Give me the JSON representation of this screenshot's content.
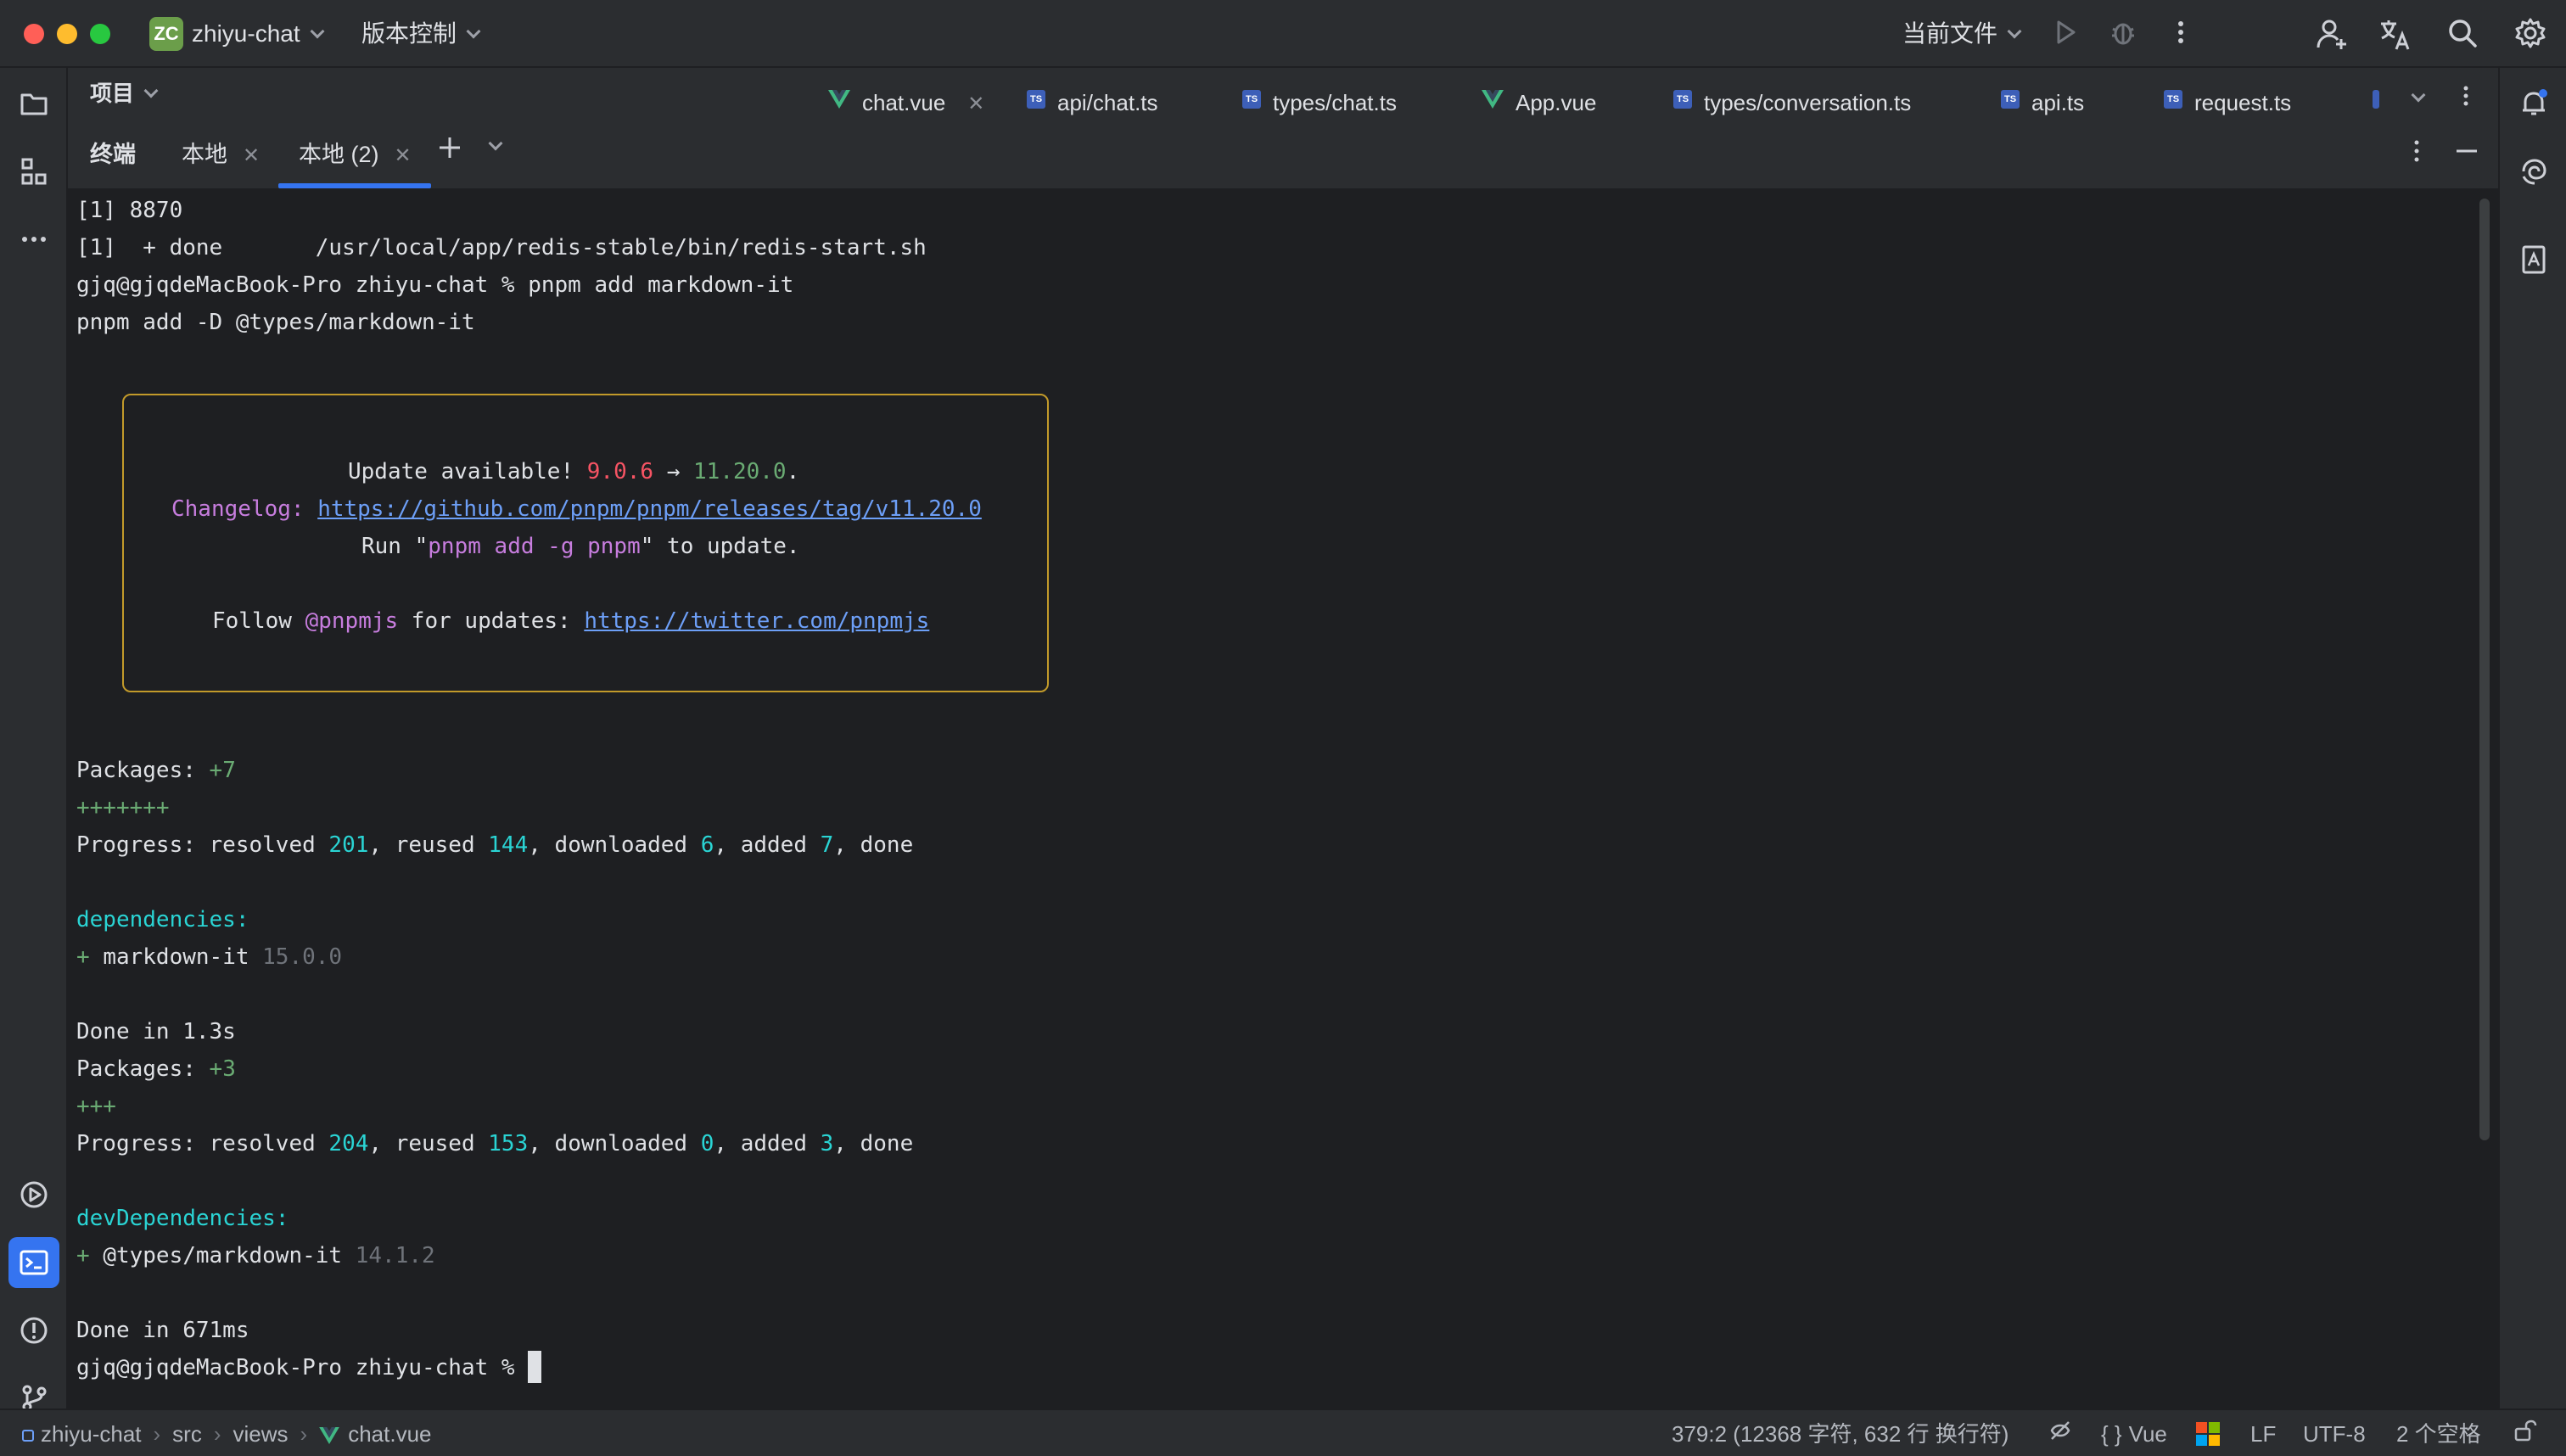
{
  "titlebar": {
    "project_badge": "ZC",
    "project_name": "zhiyu-chat",
    "vcs": "版本控制",
    "run_config": "当前文件"
  },
  "editor": {
    "project_label": "项目",
    "tabs": [
      {
        "label": "chat.vue",
        "icon": "vue-icon",
        "active": true
      },
      {
        "label": "api/chat.ts",
        "icon": "ts-icon"
      },
      {
        "label": "types/chat.ts",
        "icon": "ts-icon"
      },
      {
        "label": "App.vue",
        "icon": "vue-icon"
      },
      {
        "label": "types/conversation.ts",
        "icon": "ts-icon"
      },
      {
        "label": "api.ts",
        "icon": "ts-icon"
      },
      {
        "label": "request.ts",
        "icon": "ts-icon"
      }
    ]
  },
  "terminal_bar": {
    "title": "终端",
    "tab1": "本地",
    "tab2": "本地 (2)"
  },
  "terminal": {
    "l1": "[1] 8870",
    "l2": "[1]  + done       /usr/local/app/redis-stable/bin/redis-start.sh",
    "l3": "gjq@gjqdeMacBook-Pro zhiyu-chat % pnpm add markdown-it",
    "l4": "pnpm add -D @types/markdown-it",
    "update_prefix": "Update available! ",
    "update_from": "9.0.6",
    "update_arrow": " → ",
    "update_to": "11.20.0",
    "update_dot": ".",
    "changelog_label": "Changelog: ",
    "changelog_url": "https://github.com/pnpm/pnpm/releases/tag/v11.20.0",
    "run_prefix": "Run \"",
    "run_cmd": "pnpm add -g pnpm",
    "run_suffix": "\" to update.",
    "follow_prefix": "Follow ",
    "follow_handle": "@pnpmjs",
    "follow_mid": " for updates: ",
    "follow_url": "https://twitter.com/pnpmjs",
    "pkg1_label": "Packages: ",
    "pkg1_count": "+7",
    "pkg1_plus": "+++++++",
    "prog1": {
      "a": "Progress: resolved ",
      "resolved": "201",
      "b": ", reused ",
      "reused": "144",
      "c": ", downloaded ",
      "downloaded": "6",
      "d": ", added ",
      "added": "7",
      "e": ", done"
    },
    "deps_label": "dependencies:",
    "dep_plus": "+ ",
    "dep_name": "markdown-it ",
    "dep_version": "15.0.0",
    "done1": "Done in 1.3s",
    "pkg2_label": "Packages: ",
    "pkg2_count": "+3",
    "pkg2_plus": "+++",
    "prog2": {
      "a": "Progress: resolved ",
      "resolved": "204",
      "b": ", reused ",
      "reused": "153",
      "c": ", downloaded ",
      "downloaded": "0",
      "d": ", added ",
      "added": "3",
      "e": ", done"
    },
    "devdeps_label": "devDependencies:",
    "devdep_plus": "+ ",
    "devdep_name": "@types/markdown-it ",
    "devdep_version": "14.1.2",
    "done2": "Done in 671ms",
    "prompt": "gjq@gjqdeMacBook-Pro zhiyu-chat % "
  },
  "statusbar": {
    "crumb1": "zhiyu-chat",
    "crumb2": "src",
    "crumb3": "views",
    "crumb4": "chat.vue",
    "position": "379:2 (12368 字符, 632 行 换行符)",
    "language": "Vue",
    "line_sep": "LF",
    "encoding": "UTF-8",
    "indent": "2 个空格"
  },
  "colors": {
    "accent": "#3574f0",
    "box_border": "#c29a2a",
    "error_red": "#f75464",
    "success_green": "#6aab73",
    "cyan": "#2ad4d4",
    "purple": "#c77dde"
  }
}
